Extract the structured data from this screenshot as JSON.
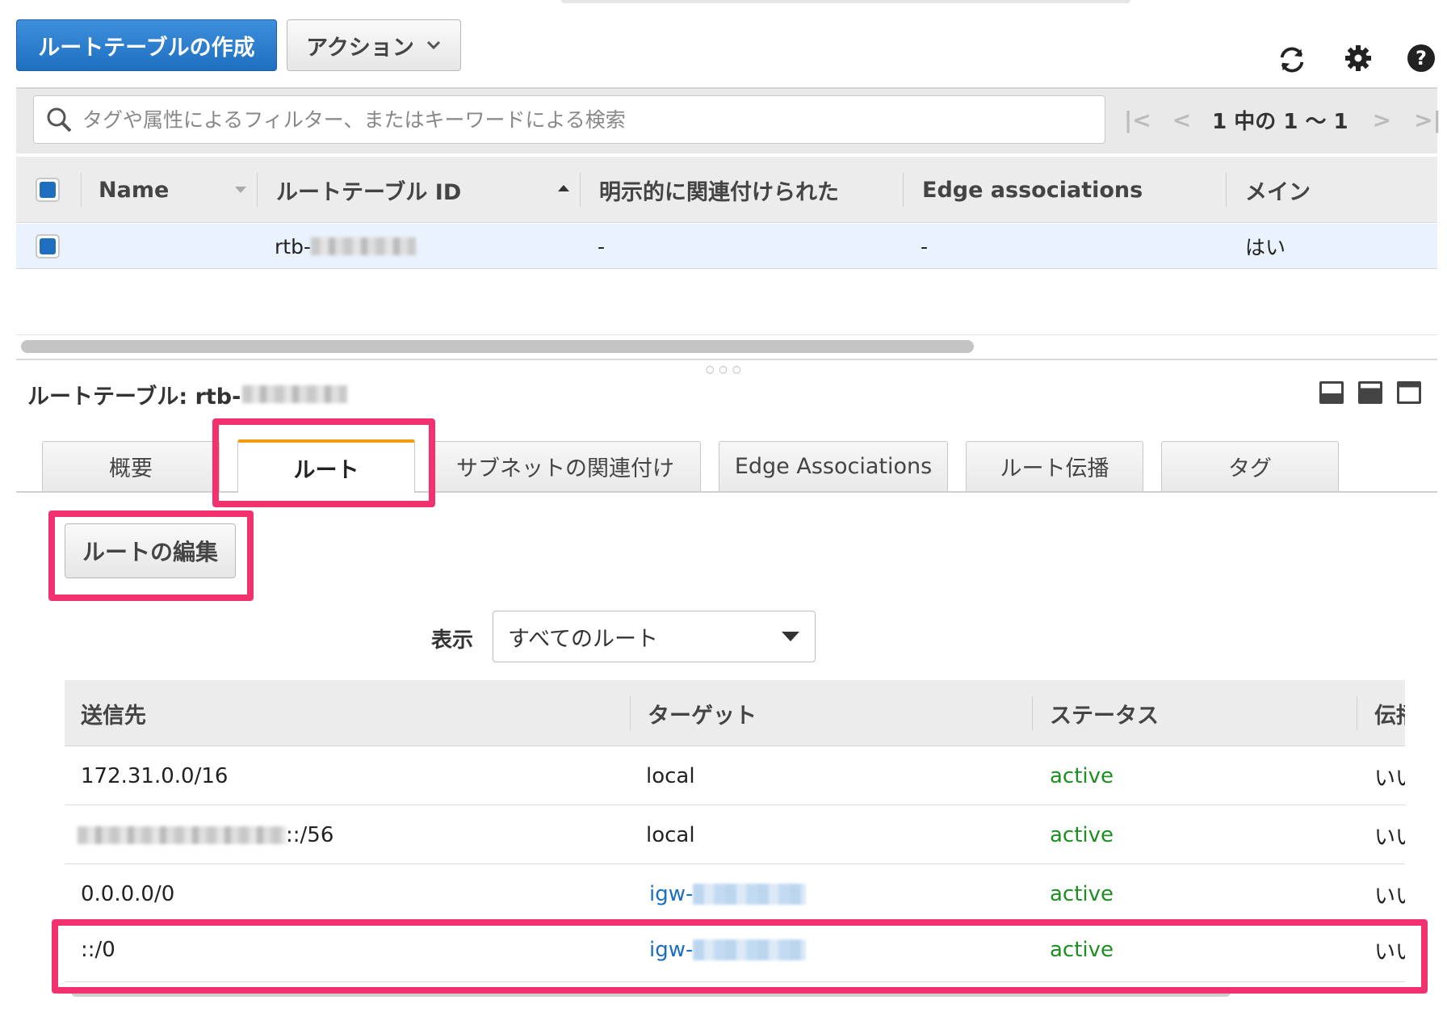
{
  "toolbar": {
    "create_label": "ルートテーブルの作成",
    "actions_label": "アクション"
  },
  "icons": {
    "refresh": "refresh-icon",
    "settings": "gear-icon",
    "help": "help-icon",
    "search": "search-icon"
  },
  "search": {
    "placeholder": "タグや属性によるフィルター、またはキーワードによる検索"
  },
  "pagination": {
    "label": "1 中の 1 〜 1"
  },
  "table": {
    "columns": [
      "Name",
      "ルートテーブル ID",
      "明示的に関連付けられた",
      "Edge associations",
      "メイン"
    ],
    "rows": [
      {
        "name": "",
        "id": "rtb-",
        "explicit": "-",
        "edge": "-",
        "main": "はい"
      }
    ]
  },
  "detail": {
    "title": "ルートテーブル: rtb-",
    "tabs": [
      "概要",
      "ルート",
      "サブネットの関連付け",
      "Edge Associations",
      "ルート伝播",
      "タグ"
    ],
    "active_tab": "ルート",
    "edit_routes_label": "ルートの編集",
    "show_label": "表示",
    "filter_value": "すべてのルート"
  },
  "routes": {
    "columns": [
      "送信先",
      "ターゲット",
      "ステータス",
      "伝播"
    ],
    "rows": [
      {
        "destination": "172.31.0.0/16",
        "target": "local",
        "status": "active",
        "propagated": "いいえ"
      },
      {
        "destination": "::/56",
        "target": "local",
        "status": "active",
        "propagated": "いいえ"
      },
      {
        "destination": "0.0.0.0/0",
        "target": "igw-",
        "status": "active",
        "propagated": "いいえ"
      },
      {
        "destination": "::/0",
        "target": "igw-",
        "status": "active",
        "propagated": "いいえ"
      }
    ]
  },
  "colors": {
    "primary": "#1f6fc0",
    "active_tab_accent": "#f39c12",
    "highlight": "#f2326e",
    "status_active": "#1d8f22",
    "link": "#1a6fc4"
  }
}
